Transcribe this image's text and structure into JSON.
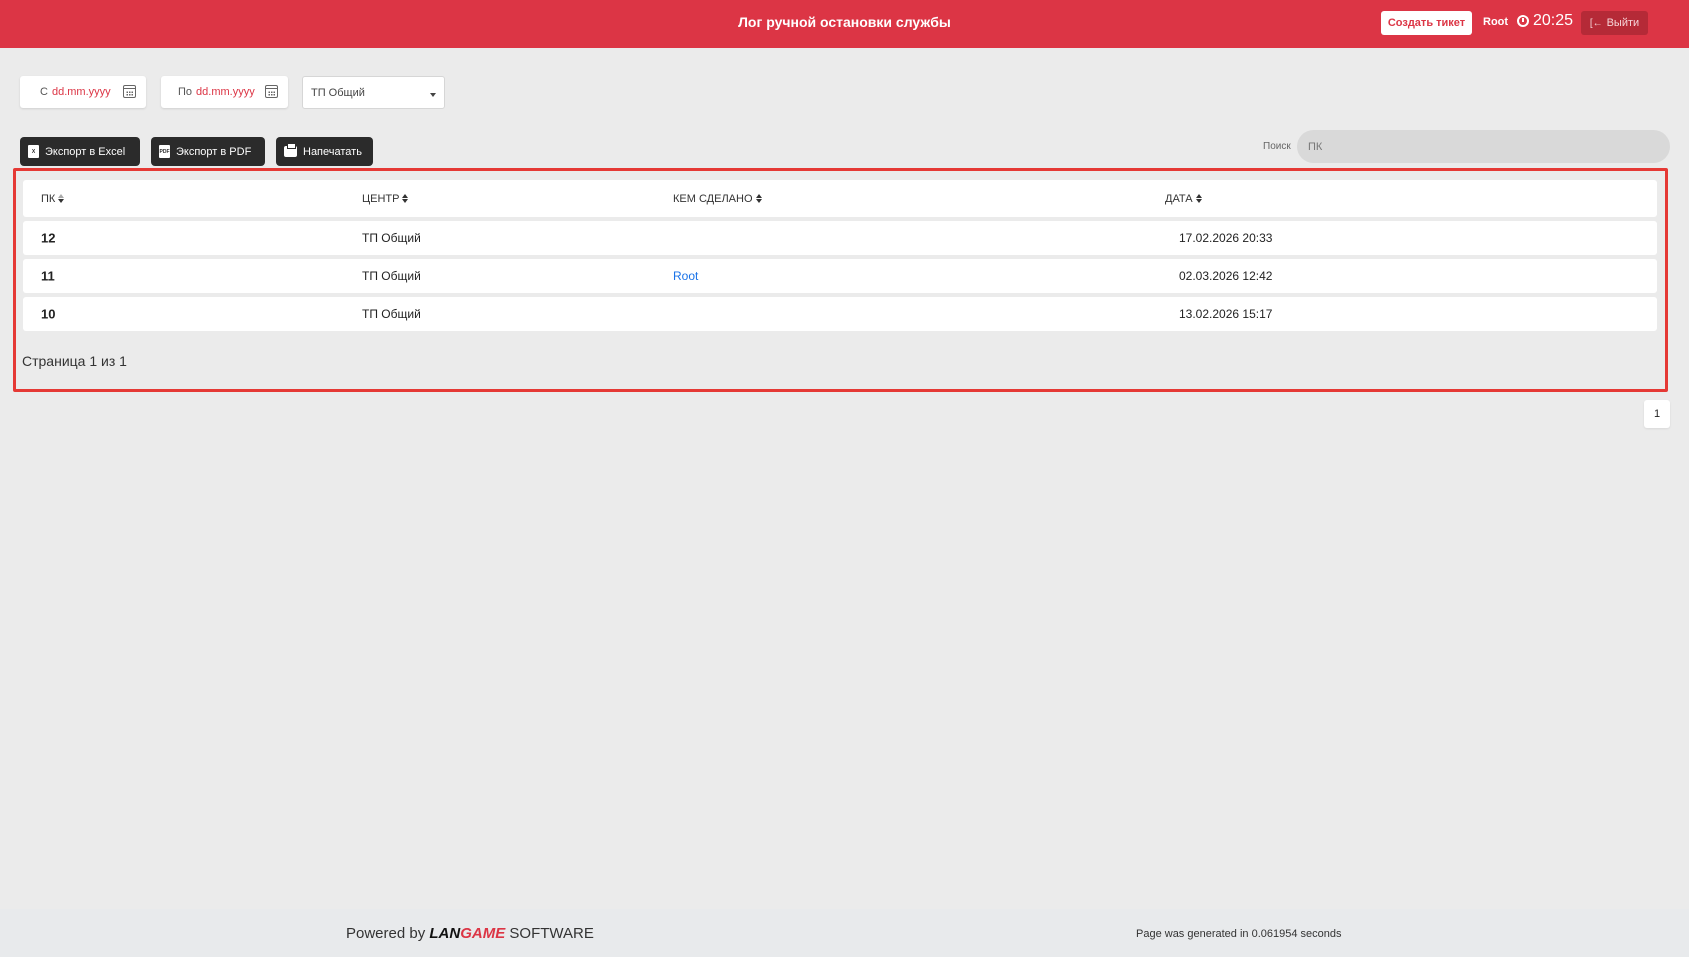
{
  "header": {
    "title": "Лог ручной остановки службы",
    "create_ticket": "Создать тикет",
    "user": "Root",
    "time": "20:25",
    "logout": "Выйти"
  },
  "filters": {
    "from_label": "С",
    "from_value": "dd.mm.yyyy",
    "to_label": "По",
    "to_value": "dd.mm.yyyy",
    "center_select": "ТП Общий"
  },
  "toolbar": {
    "export_excel": "Экспорт в Excel",
    "export_pdf": "Экспорт в PDF",
    "print": "Напечатать",
    "search_label": "Поиск",
    "search_placeholder": "ПК"
  },
  "table": {
    "columns": [
      "ПК",
      "ЦЕНТР",
      "КЕМ СДЕЛАНО",
      "ДАТА"
    ],
    "rows": [
      {
        "pk": "12",
        "center": "ТП Общий",
        "who": "",
        "date": "17.02.2026 20:33"
      },
      {
        "pk": "11",
        "center": "ТП Общий",
        "who": "Root",
        "date": "02.03.2026 12:42"
      },
      {
        "pk": "10",
        "center": "ТП Общий",
        "who": "",
        "date": "13.02.2026 15:17"
      }
    ],
    "page_info": "Страница 1 из 1"
  },
  "pagination": {
    "current": "1"
  },
  "footer": {
    "powered_prefix": "Powered by",
    "brand_part1": "LAN",
    "brand_part2": "GAME",
    "brand_suffix": "SOFTWARE",
    "generated": "Page was generated in 0.061954 seconds"
  },
  "colors": {
    "primary": "#dc3545",
    "highlight_border": "#e53935",
    "link": "#1a73e8",
    "dark_button": "#2b2b2b"
  }
}
